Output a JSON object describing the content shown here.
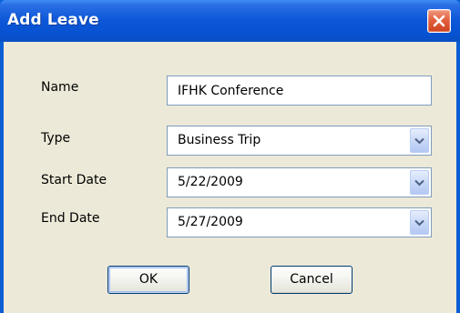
{
  "dialog": {
    "title": "Add Leave",
    "close_icon": "close-icon"
  },
  "form": {
    "name": {
      "label": "Name",
      "value": "IFHK Conference"
    },
    "type": {
      "label": "Type",
      "value": "Business Trip",
      "icon": "chevron-down-icon"
    },
    "start_date": {
      "label": "Start Date",
      "value": "5/22/2009",
      "icon": "chevron-down-icon"
    },
    "end_date": {
      "label": "End Date",
      "value": "5/27/2009",
      "icon": "chevron-down-icon"
    }
  },
  "buttons": {
    "ok": "OK",
    "cancel": "Cancel"
  },
  "colors": {
    "title_bar": "#0752d1",
    "client_background": "#ece9d8",
    "close_button": "#e3603d",
    "field_border": "#7f9db9",
    "button_border": "#003c74"
  }
}
